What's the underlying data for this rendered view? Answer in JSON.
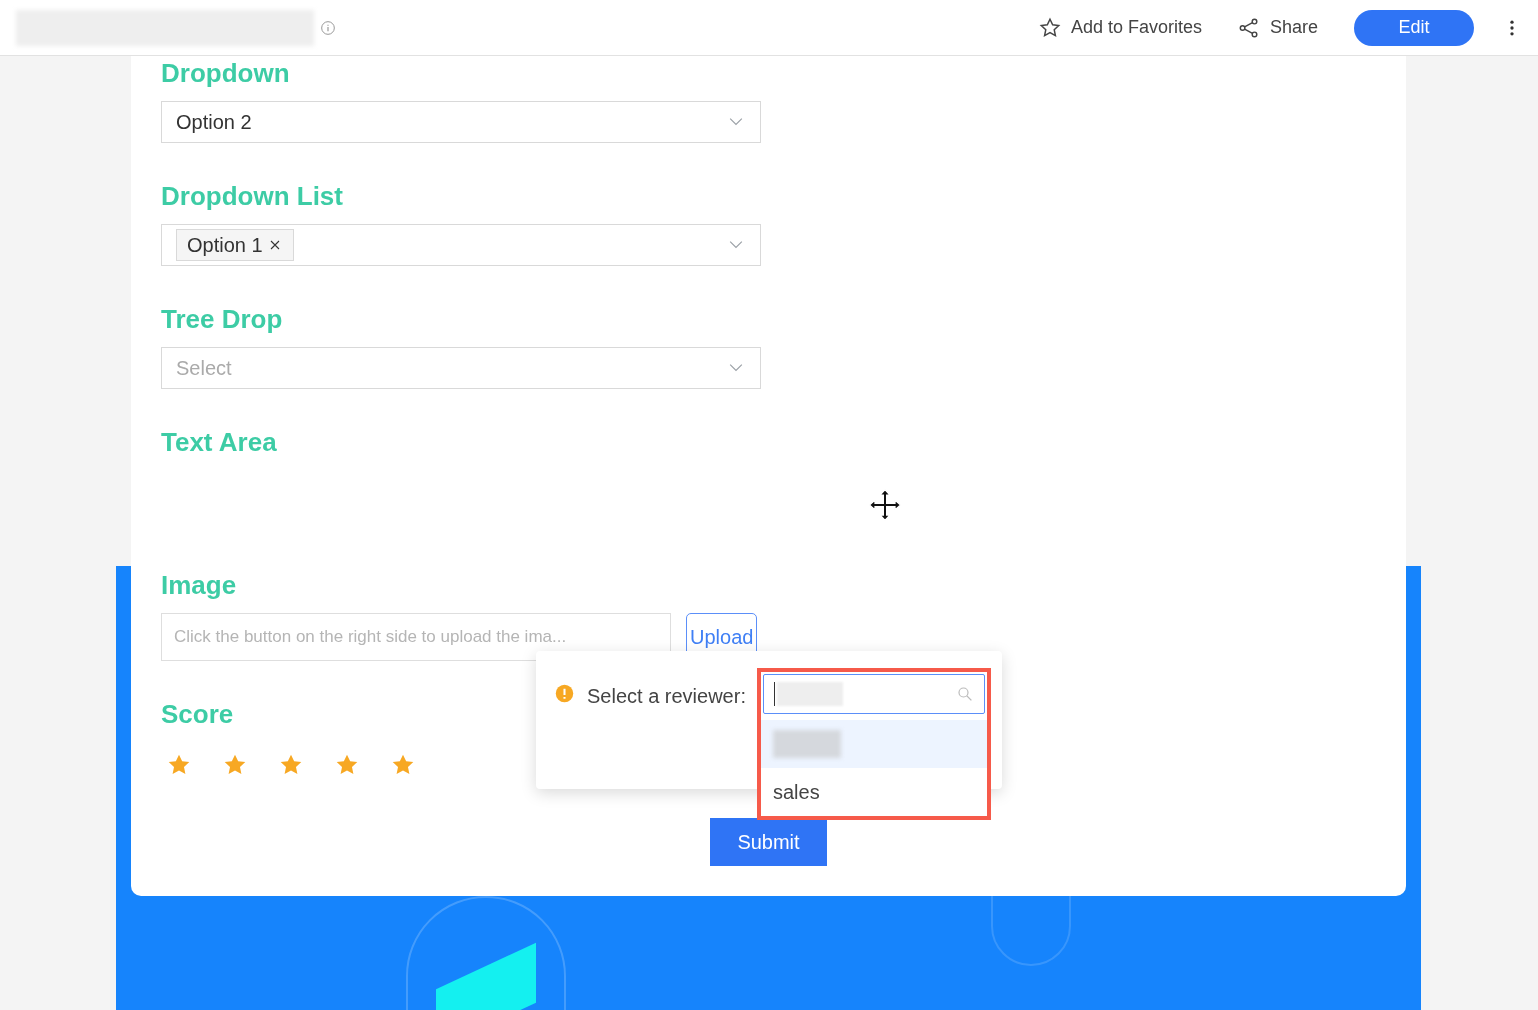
{
  "header": {
    "actions": [
      {
        "kind": "favorite",
        "label": "Add to Favorites"
      },
      {
        "kind": "share",
        "label": "Share"
      },
      {
        "kind": "primary",
        "label": "Edit"
      }
    ]
  },
  "form": {
    "fields": [
      {
        "kind": "select",
        "label": "Dropdown",
        "value": "Option 2"
      },
      {
        "kind": "multiselect",
        "label": "Dropdown List",
        "tags": [
          "Option 1"
        ]
      },
      {
        "kind": "select",
        "label": "Tree Drop",
        "placeholder": "Select"
      },
      {
        "kind": "textarea",
        "label": "Text Area"
      },
      {
        "kind": "upload",
        "label": "Image",
        "placeholder": "Click the button on the right side to upload the ima...",
        "button": "Upload"
      },
      {
        "kind": "rating",
        "label": "Score",
        "stars": 5
      }
    ],
    "submit": "Submit"
  },
  "popover": {
    "label": "Select a reviewer:",
    "options": [
      {
        "blurred": true,
        "highlighted": true
      },
      {
        "text": "sales",
        "blurred": false,
        "highlighted": false
      }
    ]
  }
}
